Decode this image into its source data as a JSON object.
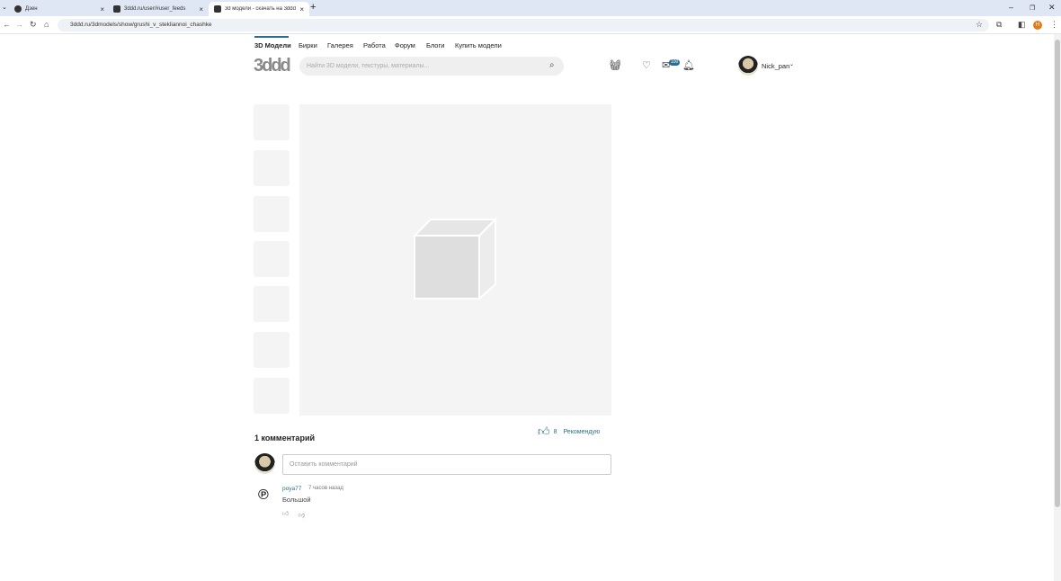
{
  "browser": {
    "tabs": [
      {
        "title": "Дзен"
      },
      {
        "title": "3ddd.ru/user/#user_feeds"
      },
      {
        "title": "3d модели - скачать на 3ddd"
      }
    ],
    "url": "3ddd.ru/3dmodels/show/grushi_v_stekliannoi_chashke",
    "profile_initial": "H"
  },
  "nav": {
    "items": [
      "3D Модели",
      "Бирки",
      "Галерея",
      "Работа",
      "Форум",
      "Блоги",
      "Купить модели"
    ],
    "active": "3D Модели"
  },
  "header": {
    "logo": "3ddd",
    "search_placeholder": "Найти 3D модели, текстуры, материалы...",
    "messages_badge": "100",
    "username": "Nick_pan"
  },
  "product": {
    "recommend_count": "8",
    "recommend_label": "Рекомендую"
  },
  "comments": {
    "title": "1 комментарий",
    "input_placeholder": "Оставить комментарий",
    "items": [
      {
        "author": "poya77",
        "time": "7 часов назад",
        "text": "Большой"
      }
    ]
  },
  "colors": {
    "accent": "#2a6f8f"
  }
}
